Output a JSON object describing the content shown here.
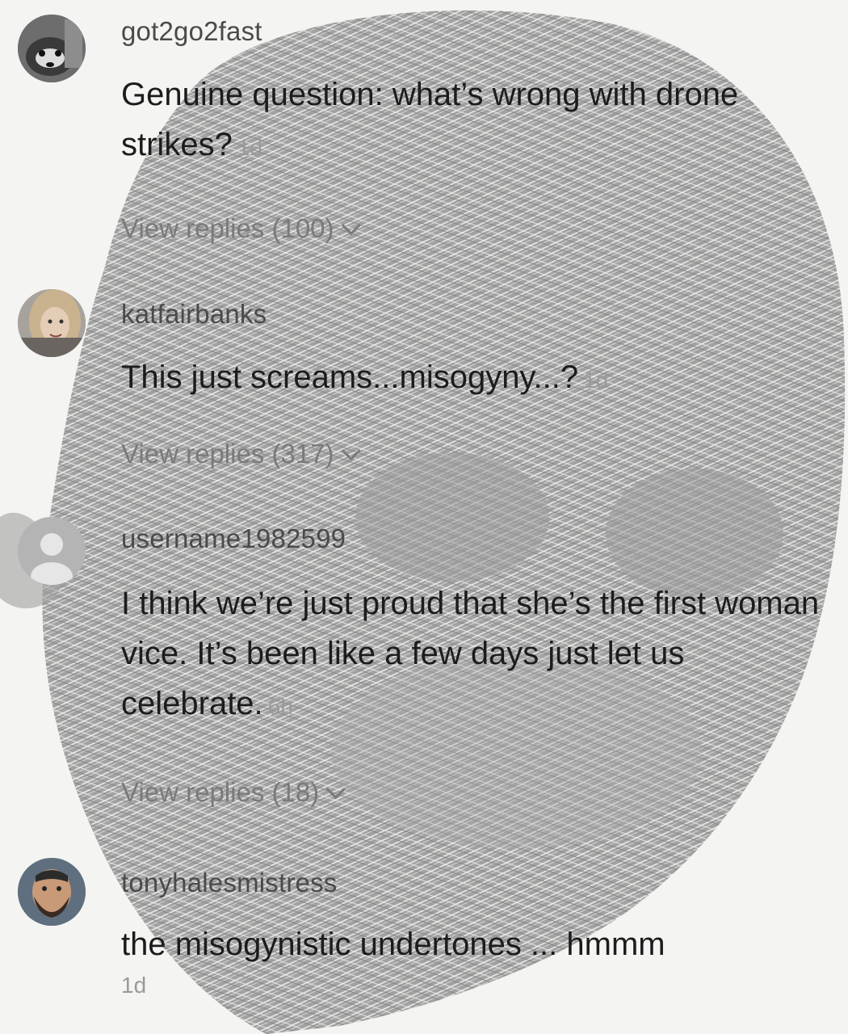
{
  "comments": [
    {
      "username": "got2go2fast",
      "text": "Genuine question: what’s wrong with drone strikes?",
      "time": "1d",
      "replies": "View replies (100)",
      "avatar_icon": "raccoon-avatar-icon"
    },
    {
      "username": "katfairbanks",
      "text": "This just screams...misogyny...?",
      "time": "1d",
      "replies": "View replies (317)",
      "avatar_icon": "woman-avatar-icon"
    },
    {
      "username": "username1982599",
      "text": "I think we’re just proud that she’s the first woman vice. It’s been like a few days just let us celebrate.",
      "time": "6h",
      "replies": "View replies (18)",
      "avatar_icon": "default-avatar-icon"
    },
    {
      "username": "tonyhalesmistress",
      "text": "the misogynistic undertones ... hmmm",
      "time": "1d",
      "avatar_icon": "bearded-man-avatar-icon"
    }
  ],
  "colors": {
    "background": "#f4f4f2",
    "watermark": "#8e8e8e",
    "username": "#4a4a4a",
    "text": "#1c1c1c",
    "meta": "#9a9a9a"
  }
}
